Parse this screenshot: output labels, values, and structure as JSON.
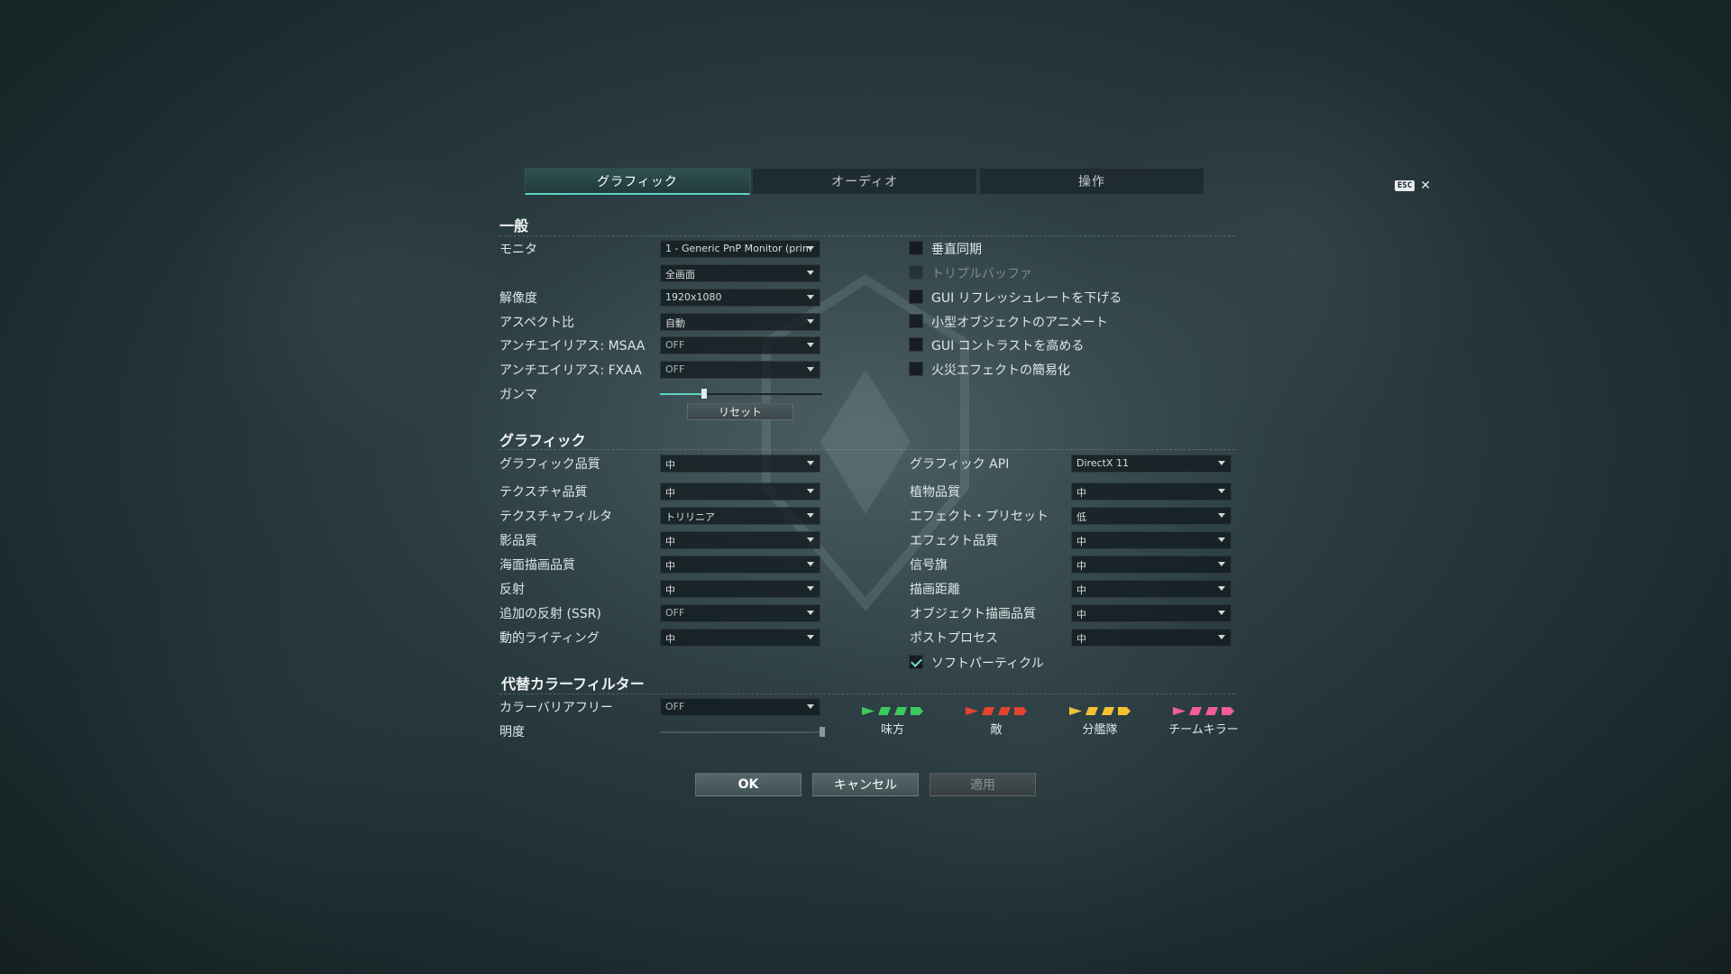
{
  "tabs": [
    {
      "label": "グラフィック",
      "active": true
    },
    {
      "label": "オーディオ",
      "active": false
    },
    {
      "label": "操作",
      "active": false
    }
  ],
  "close": {
    "key": "ESC",
    "symbol": "✕"
  },
  "general": {
    "title": "一般",
    "rows": {
      "monitor": {
        "label": "モニタ",
        "value": "1 - Generic PnP Monitor (prim"
      },
      "window_mode": {
        "label": "",
        "value": "全画面"
      },
      "resolution": {
        "label": "解像度",
        "value": "1920x1080"
      },
      "aspect": {
        "label": "アスペクト比",
        "value": "自動"
      },
      "msaa": {
        "label": "アンチエイリアス: MSAA",
        "value": "OFF"
      },
      "fxaa": {
        "label": "アンチエイリアス: FXAA",
        "value": "OFF"
      },
      "gamma": {
        "label": "ガンマ",
        "level": 0.27
      }
    },
    "reset_label": "リセット",
    "checkboxes": [
      {
        "label": "垂直同期",
        "checked": false,
        "disabled": false
      },
      {
        "label": "トリプルバッファ",
        "checked": false,
        "disabled": true
      },
      {
        "label": "GUI リフレッシュレートを下げる",
        "checked": false,
        "disabled": false
      },
      {
        "label": "小型オブジェクトのアニメート",
        "checked": false,
        "disabled": false
      },
      {
        "label": "GUI コントラストを高める",
        "checked": false,
        "disabled": false
      },
      {
        "label": "火災エフェクトの簡易化",
        "checked": false,
        "disabled": false
      }
    ]
  },
  "graphics": {
    "title": "グラフィック",
    "left": [
      {
        "label": "グラフィック品質",
        "value": "中"
      },
      {
        "label": "テクスチャ品質",
        "value": "中"
      },
      {
        "label": "テクスチャフィルタ",
        "value": "トリリニア"
      },
      {
        "label": "影品質",
        "value": "中"
      },
      {
        "label": "海面描画品質",
        "value": "中"
      },
      {
        "label": "反射",
        "value": "中"
      },
      {
        "label": "追加の反射 (SSR)",
        "value": "OFF"
      },
      {
        "label": "動的ライティング",
        "value": "中"
      }
    ],
    "right": [
      {
        "label": "グラフィック API",
        "value": "DirectX 11"
      },
      {
        "label": "植物品質",
        "value": "中"
      },
      {
        "label": "エフェクト・プリセット",
        "value": "低"
      },
      {
        "label": "エフェクト品質",
        "value": "中"
      },
      {
        "label": "信号旗",
        "value": "中"
      },
      {
        "label": "描画距離",
        "value": "中"
      },
      {
        "label": "オブジェクト描画品質",
        "value": "中"
      },
      {
        "label": "ポストプロセス",
        "value": "中"
      }
    ],
    "soft_particles": {
      "label": "ソフトパーティクル",
      "checked": true
    }
  },
  "color_filter": {
    "title": "代替カラーフィルター",
    "colorblind": {
      "label": "カラーバリアフリー",
      "value": "OFF"
    },
    "brightness": {
      "label": "明度",
      "level": 1.0
    },
    "legend": [
      {
        "name": "味方",
        "color": "#3ccb5f"
      },
      {
        "name": "敵",
        "color": "#e2442f"
      },
      {
        "name": "分艦隊",
        "color": "#f3c233"
      },
      {
        "name": "チームキラー",
        "color": "#f05d9a"
      }
    ]
  },
  "buttons": {
    "ok": "OK",
    "cancel": "キャンセル",
    "apply": "適用"
  }
}
